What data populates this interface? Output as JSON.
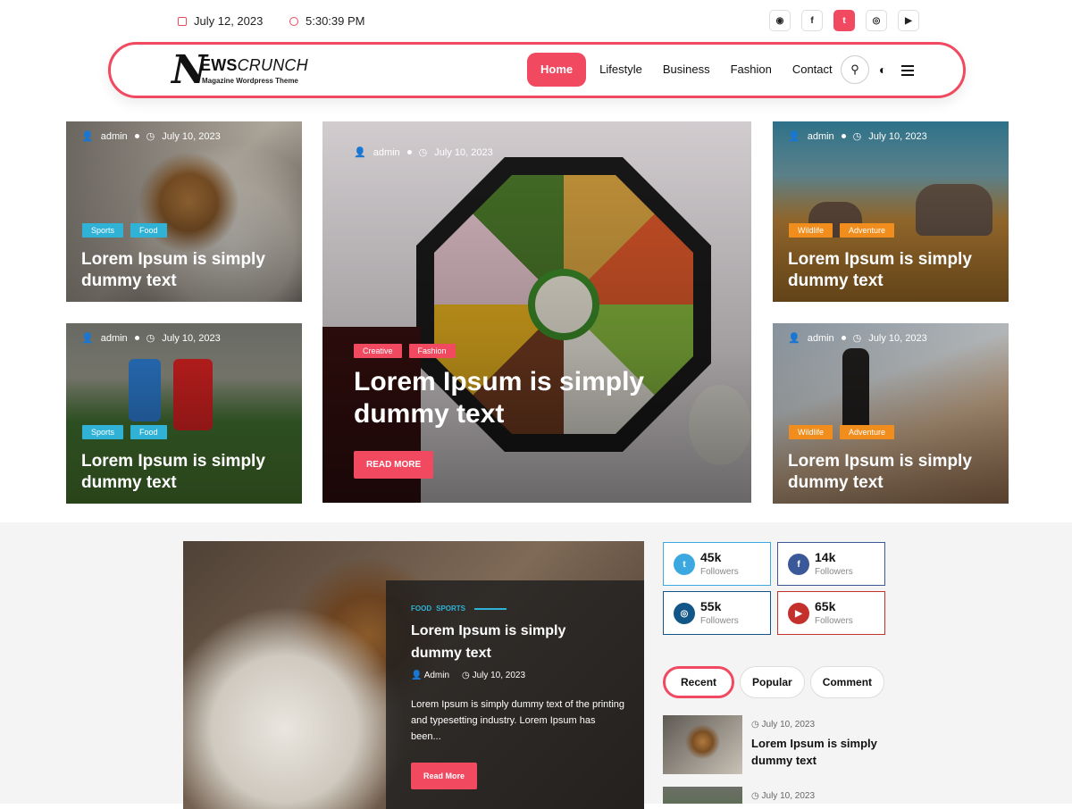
{
  "topbar": {
    "date": "July 12, 2023",
    "time": "5:30:39 PM",
    "social_icons": [
      "dribbble-icon",
      "facebook-icon",
      "twitter-icon",
      "instagram-icon",
      "youtube-icon"
    ],
    "social_labels": [
      "◉",
      "f",
      "t",
      "◎",
      "▶"
    ]
  },
  "brand": {
    "logo_letter": "N",
    "name_bold": "EWS",
    "name_light": "CRUNCH",
    "tagline": "Magazine Wordpress Theme"
  },
  "nav": {
    "items": [
      "Home",
      "Lifestyle",
      "Business",
      "Fashion",
      "Contact"
    ],
    "active": "Home",
    "search_glyph": "⚲",
    "moon_glyph": "◐"
  },
  "cards": [
    {
      "author": "admin",
      "date": "July 10, 2023",
      "tags": [
        "Sports",
        "Food"
      ],
      "title_1": "Lorem Ipsum is simply",
      "title_2": "dummy text"
    },
    {
      "author": "admin",
      "date": "July 10, 2023",
      "tags": [
        "Sports",
        "Food"
      ],
      "title_1": "Lorem Ipsum is simply",
      "title_2": "dummy text"
    },
    {
      "author": "admin",
      "date": "July 10, 2023",
      "tags": [
        "Creative",
        "Fashion"
      ],
      "title_1": "Lorem Ipsum is simply",
      "title_2": "dummy text",
      "button": "READ MORE"
    },
    {
      "author": "admin",
      "date": "July 10, 2023",
      "tags": [
        "Wildlife",
        "Adventure"
      ],
      "title_1": "Lorem Ipsum is simply",
      "title_2": "dummy text"
    },
    {
      "author": "admin",
      "date": "July 10, 2023",
      "tags": [
        "Wildlife",
        "Adventure"
      ],
      "title_1": "Lorem Ipsum is simply",
      "title_2": "dummy text"
    }
  ],
  "featured": {
    "cat_1": "FOOD",
    "cat_2": "SPORTS",
    "title_1": "Lorem Ipsum is simply",
    "title_2": "dummy text",
    "author": "Admin",
    "date": "July 10, 2023",
    "excerpt": "Lorem Ipsum is simply dummy text of the printing and typesetting industry. Lorem Ipsum has been...",
    "button": "Read More"
  },
  "followers": [
    {
      "count": "45k",
      "label": "Followers",
      "icon": "twitter-icon",
      "glyph": "t",
      "color": "#3ba9e0"
    },
    {
      "count": "14k",
      "label": "Followers",
      "icon": "facebook-icon",
      "glyph": "f",
      "color": "#3b5998"
    },
    {
      "count": "55k",
      "label": "Followers",
      "icon": "instagram-icon",
      "glyph": "◎",
      "color": "#125688"
    },
    {
      "count": "65k",
      "label": "Followers",
      "icon": "youtube-icon",
      "glyph": "▶",
      "color": "#c4302b"
    }
  ],
  "sidebar_tabs": [
    "Recent",
    "Popular",
    "Comment"
  ],
  "recent_posts": [
    {
      "date": "July 10, 2023",
      "title_1": "Lorem Ipsum is simply",
      "title_2": "dummy text"
    },
    {
      "date": "July 10, 2023"
    }
  ],
  "colors": {
    "accent": "#f04960",
    "blue_tag": "#2fb2d6",
    "orange_tag": "#f08d1d"
  }
}
